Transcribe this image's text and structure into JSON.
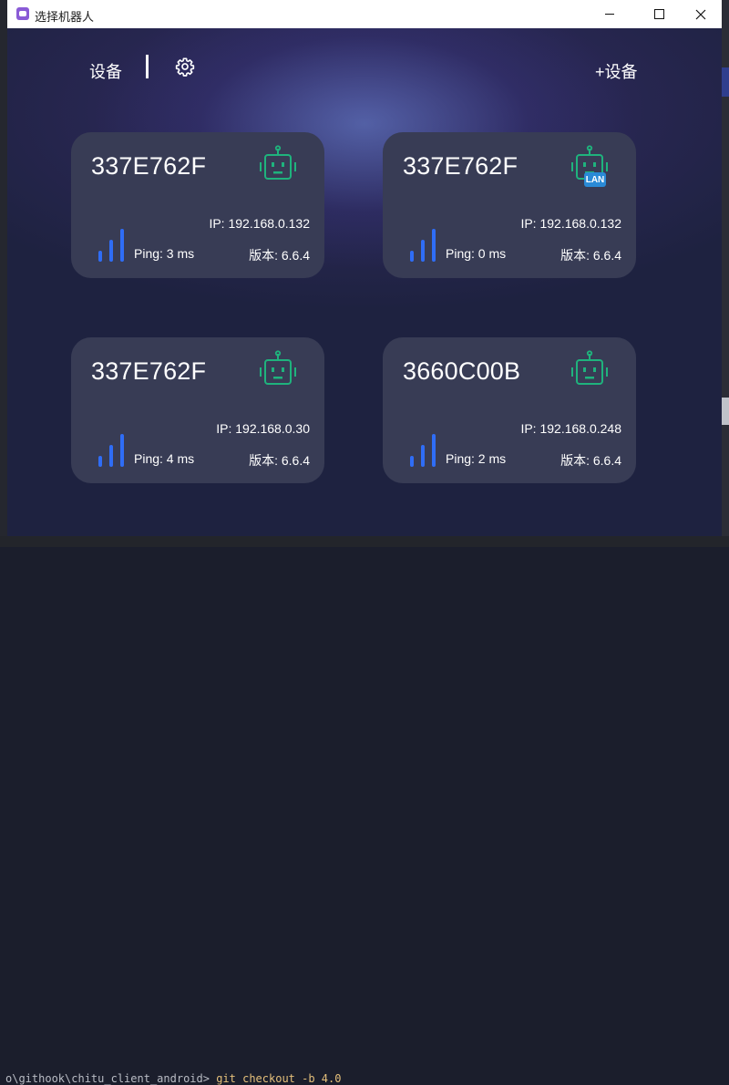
{
  "window": {
    "title": "选择机器人",
    "controls": [
      "minimize",
      "maximize",
      "close"
    ]
  },
  "header": {
    "devices_tab": "设备",
    "settings_icon": "gear-icon",
    "add_device_label": "+设备"
  },
  "devices": [
    {
      "id": "337E762F",
      "ip": "IP: 192.168.0.132",
      "ping": "Ping: 3 ms",
      "version": "版本: 6.6.4",
      "lan": false,
      "icon": "robot-icon"
    },
    {
      "id": "337E762F",
      "ip": "IP: 192.168.0.132",
      "ping": "Ping: 0 ms",
      "version": "版本: 6.6.4",
      "lan": true,
      "lan_label": "LAN",
      "icon": "robot-icon"
    },
    {
      "id": "337E762F",
      "ip": "IP: 192.168.0.30",
      "ping": "Ping: 4 ms",
      "version": "版本: 6.6.4",
      "lan": false,
      "icon": "robot-icon"
    },
    {
      "id": "3660C00B",
      "ip": "IP: 192.168.0.248",
      "ping": "Ping: 2 ms",
      "version": "版本: 6.6.4",
      "lan": false,
      "icon": "robot-icon"
    }
  ],
  "background": {
    "terminal_prompt": "o\\githook\\chitu_client_android>",
    "terminal_command": "git checkout -b 4.0"
  },
  "colors": {
    "window_bg": "#1e2240",
    "card_bg": "#383c55",
    "robot_green": "#1fb37d",
    "signal_blue": "#2f6df6",
    "lan_blue": "#2a8ad6"
  }
}
